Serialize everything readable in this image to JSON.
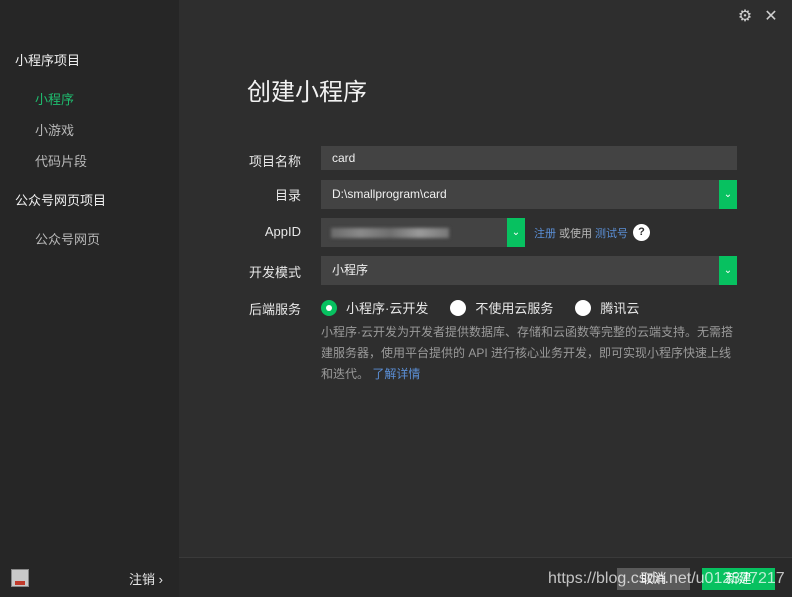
{
  "sidebar": {
    "group1": "小程序项目",
    "items1": [
      "小程序",
      "小游戏",
      "代码片段"
    ],
    "group2": "公众号网页项目",
    "items2": [
      "公众号网页"
    ],
    "logout": "注销 ›"
  },
  "window": {
    "settings_icon": "⚙",
    "close_icon": "✕"
  },
  "main": {
    "title": "创建小程序",
    "project_name_label": "项目名称",
    "project_name_value": "card",
    "dir_label": "目录",
    "dir_value": "D:\\smallprogram\\card",
    "appid_label": "AppID",
    "register_link": "注册",
    "or_use": "或使用",
    "test_link": "测试号",
    "help": "?",
    "mode_label": "开发模式",
    "mode_value": "小程序",
    "backend_label": "后端服务",
    "radio_options": [
      "小程序·云开发",
      "不使用云服务",
      "腾讯云"
    ],
    "desc": "小程序·云开发为开发者提供数据库、存储和云函数等完整的云端支持。无需搭建服务器，使用平台提供的 API 进行核心业务开发，即可实现小程序快速上线和迭代。",
    "learn_more": "了解详情"
  },
  "footer": {
    "cancel": "取消",
    "create": "新建",
    "watermark": "https://blog.csdn.net/u012377217"
  },
  "colors": {
    "accent": "#07c160",
    "active_nav": "#1fbd6f",
    "link": "#5b8fd6"
  }
}
